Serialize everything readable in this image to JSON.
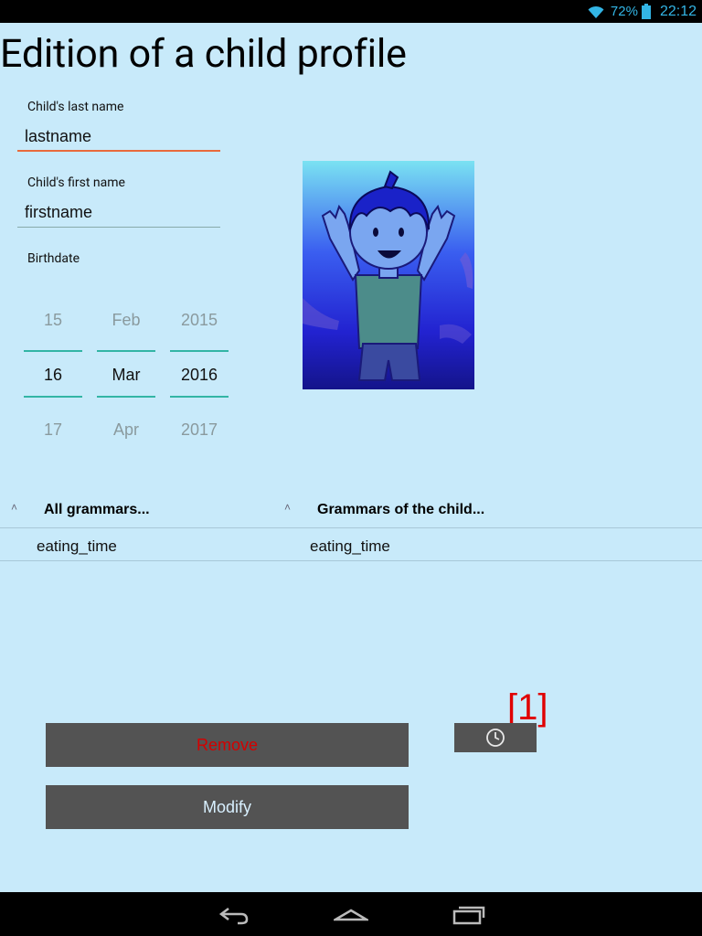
{
  "status_bar": {
    "battery_percent": "72%",
    "time": "22:12",
    "icons": [
      "wifi-icon",
      "battery-icon"
    ]
  },
  "page": {
    "title": "Edition of a child profile"
  },
  "form": {
    "last_name": {
      "label": "Child's last name",
      "value": "lastname"
    },
    "first_name": {
      "label": "Child's first name",
      "value": "firstname"
    },
    "birthdate": {
      "label": "Birthdate",
      "day": {
        "prev": "15",
        "current": "16",
        "next": "17"
      },
      "month": {
        "prev": "Feb",
        "current": "Mar",
        "next": "Apr"
      },
      "year": {
        "prev": "2015",
        "current": "2016",
        "next": "2017"
      }
    }
  },
  "photo": {
    "icon": "child-photo"
  },
  "grammars": {
    "all": {
      "header": "All grammars...",
      "items": [
        "eating_time"
      ]
    },
    "child": {
      "header": "Grammars of the child...",
      "items": [
        "eating_time"
      ]
    }
  },
  "actions": {
    "remove_label": "Remove",
    "modify_label": "Modify",
    "clock_icon": "clock-icon",
    "badge": "[1]"
  },
  "nav_bar": {
    "icons": [
      "back-icon",
      "home-icon",
      "recent-apps-icon"
    ]
  },
  "colors": {
    "background": "#c8eafa",
    "accent_input": "#e86a3c",
    "picker_line": "#33b5a5",
    "button_bg": "#535353",
    "remove_text": "#d40000",
    "badge": "#e00000",
    "status_text": "#33b5e5"
  }
}
